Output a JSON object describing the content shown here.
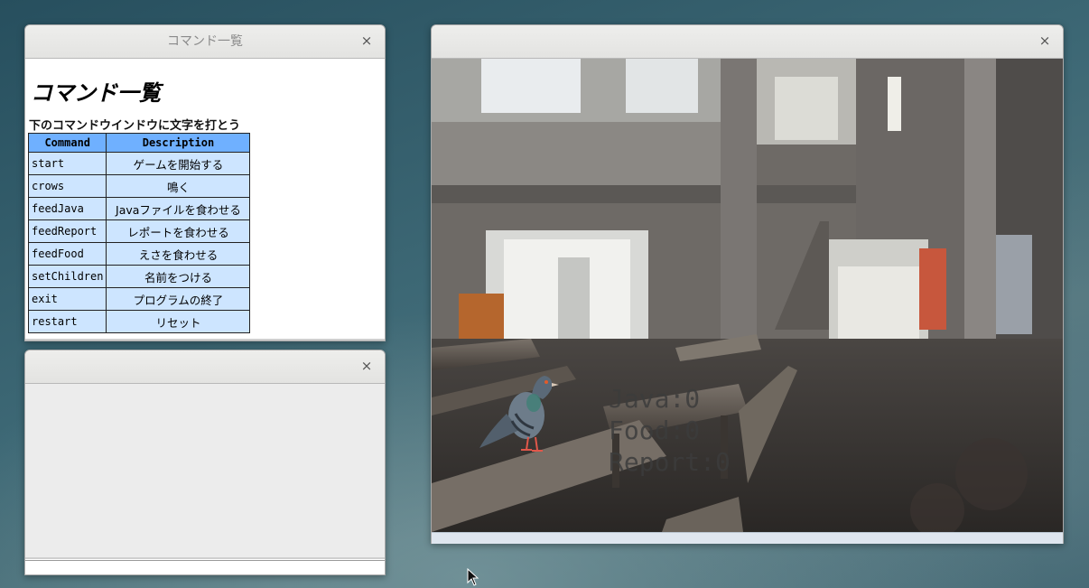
{
  "command_window": {
    "title": "コマンド一覧",
    "heading": "コマンド一覧",
    "lead": "下のコマンドウインドウに文字を打とう",
    "table": {
      "headers": [
        "Command",
        "Description"
      ],
      "rows": [
        {
          "command": "start",
          "description": "ゲームを開始する"
        },
        {
          "command": "crows",
          "description": "鳴く"
        },
        {
          "command": "feedJava",
          "description": "Javaファイルを食わせる"
        },
        {
          "command": "feedReport",
          "description": "レポートを食わせる"
        },
        {
          "command": "feedFood",
          "description": "えさを食わせる"
        },
        {
          "command": "setChildren",
          "description": "名前をつける"
        },
        {
          "command": "exit",
          "description": "プログラムの終了"
        },
        {
          "command": "restart",
          "description": "リセット"
        }
      ]
    },
    "close_label": "×"
  },
  "console_window": {
    "title": "",
    "close_label": "×",
    "input_value": ""
  },
  "game_window": {
    "title": "",
    "close_label": "×",
    "hud": {
      "java": "Java:0",
      "food": "Food:0",
      "report": "Report:0"
    }
  },
  "icons": {
    "cursor": "arrow-cursor-icon",
    "character": "pigeon-icon",
    "close": "close-icon"
  },
  "colors": {
    "table_header": "#6fb0ff",
    "table_cell": "#cde5ff"
  }
}
